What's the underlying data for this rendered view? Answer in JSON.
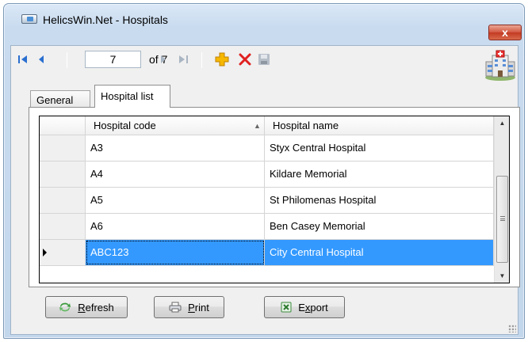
{
  "window": {
    "title": "HelicsWin.Net - Hospitals",
    "close_label": "x"
  },
  "toolbar": {
    "current_position": "7",
    "of_label": "of 7"
  },
  "tabs": [
    {
      "label": "General"
    },
    {
      "label": "Hospital list"
    }
  ],
  "grid": {
    "columns": [
      {
        "label": "Hospital code",
        "sort": "ascending"
      },
      {
        "label": "Hospital name"
      }
    ],
    "rows": [
      {
        "code": "A3",
        "name": "Styx Central Hospital",
        "selected": false
      },
      {
        "code": "A4",
        "name": "Kildare Memorial",
        "selected": false
      },
      {
        "code": "A5",
        "name": "St Philomenas Hospital",
        "selected": false
      },
      {
        "code": "A6",
        "name": "Ben Casey Memorial",
        "selected": false
      },
      {
        "code": "ABC123",
        "name": "City Central Hospital",
        "selected": true
      }
    ]
  },
  "buttons": {
    "refresh_rest": "efresh",
    "refresh_hotkey": "R",
    "print_rest": "rint",
    "print_hotkey": "P",
    "export_rest": "port",
    "export_prefix": "E",
    "export_hotkey": "x"
  },
  "colors": {
    "selection": "#3399ff",
    "delete": "#e02020",
    "add": "#f2a900"
  }
}
